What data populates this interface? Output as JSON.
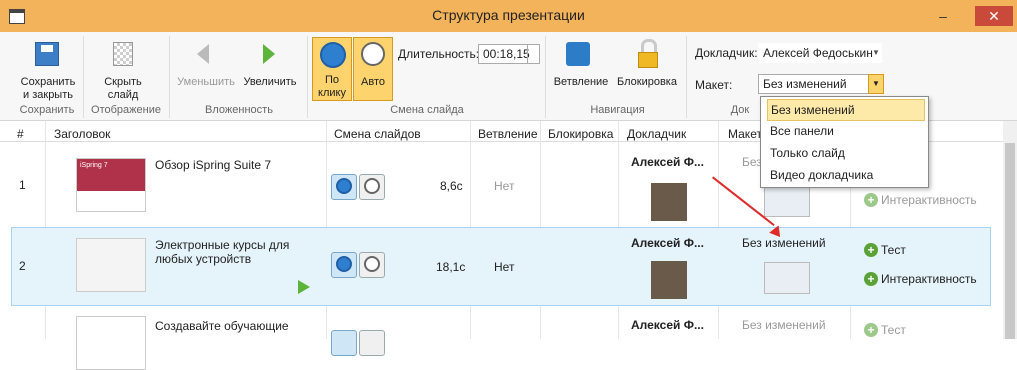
{
  "window": {
    "title": "Структура презентации",
    "minimize": "–",
    "close": "✕"
  },
  "ribbon": {
    "save": {
      "label1": "Сохранить",
      "label2": "и закрыть",
      "group": "Сохранить"
    },
    "hide": {
      "label1": "Скрыть",
      "label2": "слайд",
      "group": "Отображение"
    },
    "nesting": {
      "decrease": "Уменьшить",
      "increase": "Увеличить",
      "group": "Вложенность"
    },
    "transition": {
      "click1": "По",
      "click2": "клику",
      "auto": "Авто",
      "duration_label": "Длительность:",
      "duration_value": "00:18,15",
      "group": "Смена слайда"
    },
    "navigation": {
      "branch": "Ветвление",
      "lock": "Блокировка",
      "group": "Навигация"
    },
    "narrator": {
      "presenter_label": "Докладчик:",
      "presenter_value": "Алексей Федоськин",
      "layout_label": "Макет:",
      "layout_value": "Без изменений",
      "group": "Док"
    }
  },
  "table": {
    "headers": {
      "num": "#",
      "title": "Заголовок",
      "transition": "Смена слайдов",
      "branching": "Ветвление",
      "lock": "Блокировка",
      "presenter": "Докладчик",
      "layout": "Макет"
    },
    "rows": [
      {
        "num": "1",
        "title": "Обзор iSpring Suite 7",
        "title2": "",
        "time": "8,6с",
        "branch": "Нет",
        "presenter": "Алексей Ф...",
        "layout": "Без изменений",
        "quiz": "",
        "interact": "Интерактивность"
      },
      {
        "num": "2",
        "title": "Электронные курсы для",
        "title2": "любых устройств",
        "time": "18,1с",
        "branch": "Нет",
        "presenter": "Алексей Ф...",
        "layout": "Без изменений",
        "quiz": "Тест",
        "interact": "Интерактивность"
      },
      {
        "num": "",
        "title": "Создавайте обучающие",
        "title2": "",
        "time": "",
        "branch": "",
        "presenter": "Алексей Ф...",
        "layout": "Без изменений",
        "quiz": "Тест",
        "interact": ""
      }
    ]
  },
  "dropdown": {
    "options": [
      "Без изменений",
      "Все панели",
      "Только слайд",
      "Видео докладчика"
    ]
  },
  "thumb1_title": "iSpring 7"
}
